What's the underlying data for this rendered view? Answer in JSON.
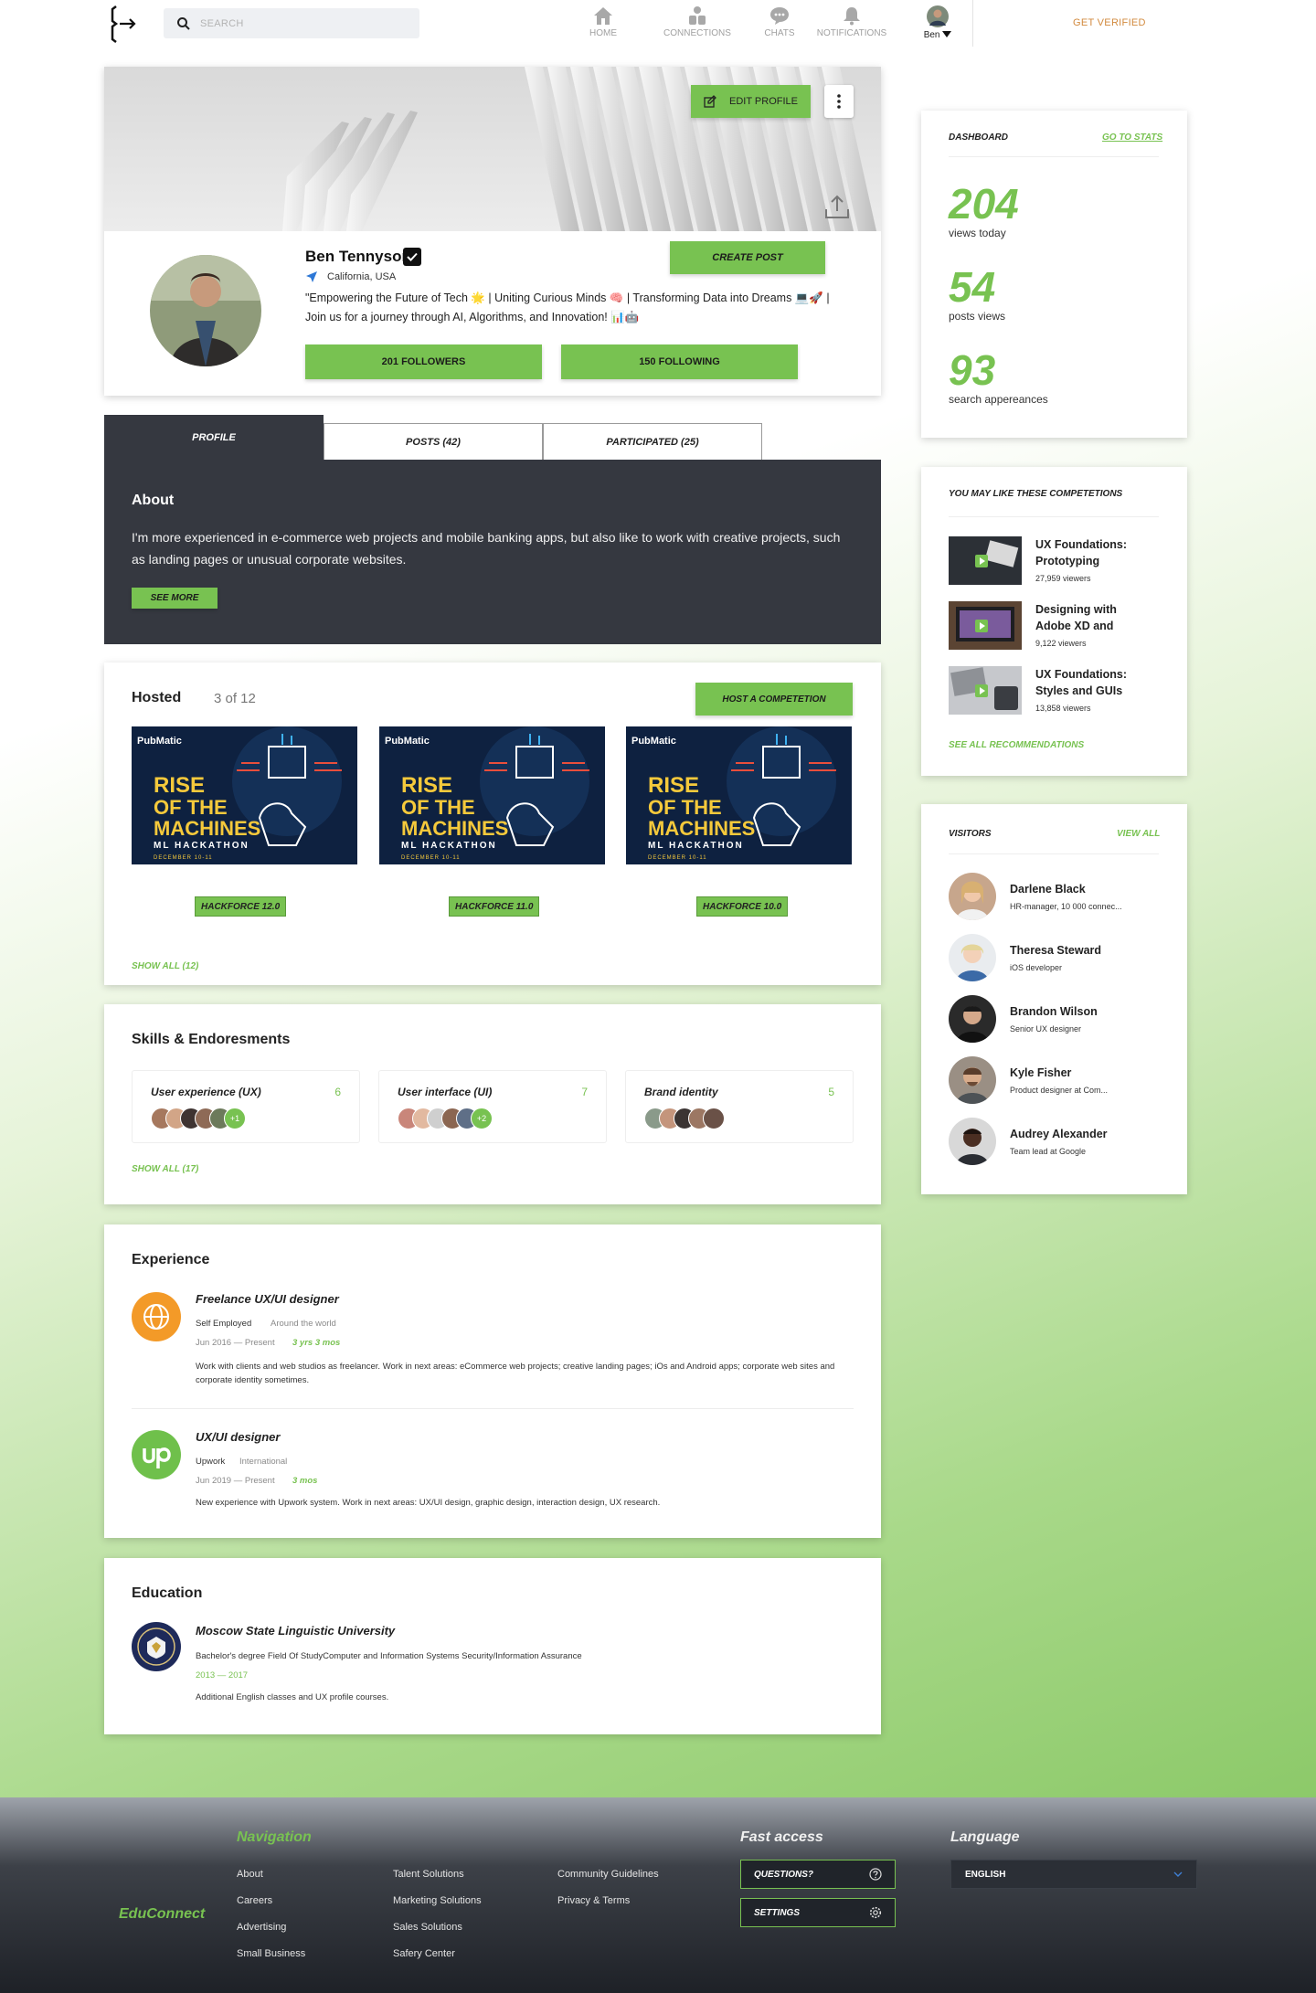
{
  "topbar": {
    "search_placeholder": "SEARCH",
    "nav": [
      {
        "label": "HOME",
        "icon": "home-icon"
      },
      {
        "label": "CONNECTIONS",
        "icon": "connections-icon"
      },
      {
        "label": "CHATS",
        "icon": "chat-icon"
      },
      {
        "label": "NOTIFICATIONS",
        "icon": "bell-icon"
      }
    ],
    "user_label": "Ben",
    "get_verified": "GET VERIFIED"
  },
  "profile": {
    "edit_label": "EDIT PROFILE",
    "name": "Ben Tennyson",
    "location": "California, USA",
    "bio": "\"Empowering the Future of Tech 🌟 | Uniting Curious Minds 🧠 | Transforming Data into Dreams 💻🚀 | Join us for a journey through AI, Algorithms, and Innovation! 📊🤖",
    "create_post": "CREATE POST",
    "followers": "201 FOLLOWERS",
    "following": "150 FOLLOWING"
  },
  "tabs": [
    {
      "label": "PROFILE",
      "active": true
    },
    {
      "label": "POSTS (42)",
      "active": false
    },
    {
      "label": "PARTICIPATED (25)",
      "active": false
    }
  ],
  "about": {
    "title": "About",
    "text": "I'm more experienced in e-commerce web projects and mobile banking apps, but also like to work with creative projects, such as landing pages or unusual corporate websites.",
    "see_more": "SEE MORE"
  },
  "hosted": {
    "title": "Hosted",
    "count": "3 of 12",
    "host_btn": "HOST A COMPETETION",
    "poster": {
      "brand": "PubMatic",
      "line1": "RISE",
      "line2": "OF THE",
      "line3": "MACHINES",
      "sub": "ML HACKATHON",
      "date": "DECEMBER 10-11"
    },
    "items": [
      {
        "label": "HACKFORCE 12.0"
      },
      {
        "label": "HACKFORCE 11.0"
      },
      {
        "label": "HACKFORCE 10.0"
      }
    ],
    "show_all": "SHOW ALL (12)"
  },
  "skills": {
    "title": "Skills & Endoresments",
    "items": [
      {
        "name": "User experience (UX)",
        "count": "6",
        "more": "+1"
      },
      {
        "name": "User interface (UI)",
        "count": "7",
        "more": "+2"
      },
      {
        "name": "Brand identity",
        "count": "5",
        "more": ""
      }
    ],
    "show_all": "SHOW ALL (17)"
  },
  "experience": {
    "title": "Experience",
    "items": [
      {
        "role": "Freelance UX/UI designer",
        "company": "Self Employed",
        "place": "Around the world",
        "dates": "Jun 2016 — Present",
        "duration": "3 yrs 3 mos",
        "desc": "Work with clients and web studios as freelancer.  Work in next areas: eCommerce web projects; creative landing pages; iOs and Android apps; corporate web sites and corporate identity sometimes."
      },
      {
        "role": "UX/UI designer",
        "company": "Upwork",
        "place": "International",
        "dates": "Jun 2019 — Present",
        "duration": "3 mos",
        "desc": "New experience with Upwork system. Work in next areas: UX/UI design, graphic design, interaction design, UX research."
      }
    ]
  },
  "education": {
    "title": "Education",
    "school": "Moscow State Linguistic University",
    "degree": "Bachelor's degree Field Of StudyComputer and Information Systems Security/Information Assurance",
    "years": "2013 — 2017",
    "note": "Additional English classes and UX profile courses."
  },
  "dashboard": {
    "title": "DASHBOARD",
    "link": "GO TO STATS",
    "stats": [
      {
        "value": "204",
        "label": "views today"
      },
      {
        "value": "54",
        "label": "posts views"
      },
      {
        "value": "93",
        "label": "search appereances"
      }
    ]
  },
  "competitions": {
    "title": "YOU MAY LIKE THESE COMPETETIONS",
    "items": [
      {
        "title": "UX Foundations: Prototyping",
        "views": "27,959 viewers"
      },
      {
        "title": "Designing with Adobe XD and pro",
        "views": "9,122 viewers"
      },
      {
        "title": "UX Foundations: Styles and GUIs",
        "views": "13,858 viewers"
      }
    ],
    "see_all": "SEE ALL RECOMMENDATIONS"
  },
  "visitors": {
    "title": "VISITORS",
    "link": "VIEW ALL",
    "items": [
      {
        "name": "Darlene Black",
        "role": "HR-manager, 10 000 connec..."
      },
      {
        "name": "Theresa Steward",
        "role": "iOS developer"
      },
      {
        "name": "Brandon Wilson",
        "role": "Senior UX designer"
      },
      {
        "name": "Kyle Fisher",
        "role": "Product designer at Com..."
      },
      {
        "name": "Audrey Alexander",
        "role": "Team lead at Google"
      }
    ]
  },
  "footer": {
    "brand": "EduConnect",
    "nav_title": "Navigation",
    "col1": [
      "About",
      "Careers",
      "Advertising",
      "Small Business"
    ],
    "col2": [
      "Talent Solutions",
      "Marketing Solutions",
      "Sales Solutions",
      "Safery Center"
    ],
    "col3": [
      "Community Guidelines",
      "Privacy & Terms"
    ],
    "fast_title": "Fast access",
    "questions": "QUESTIONS?",
    "settings": "SETTINGS",
    "lang_title": "Language",
    "lang_value": "ENGLISH"
  },
  "colors": {
    "accent": "#78c251",
    "dark": "#353840",
    "verified": "#d28a3e"
  }
}
